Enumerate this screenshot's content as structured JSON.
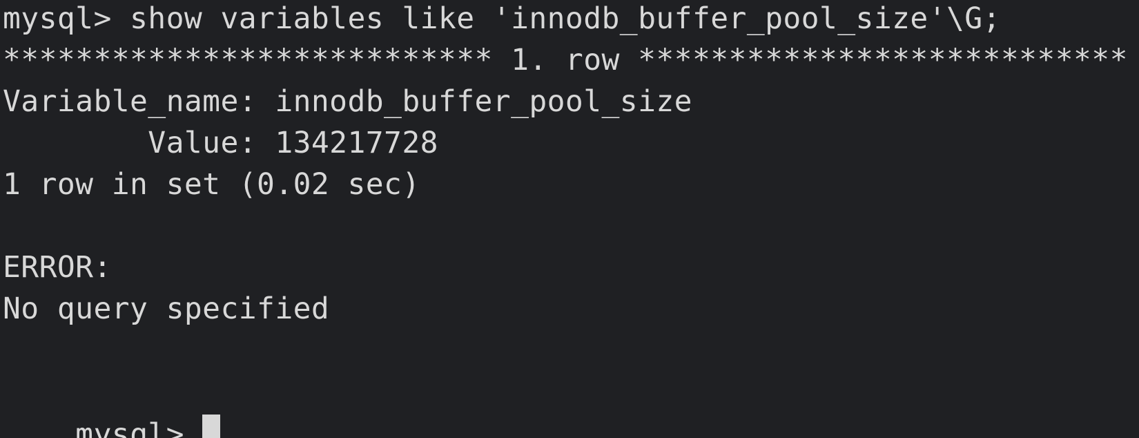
{
  "terminal": {
    "command_line": "mysql> show variables like 'innodb_buffer_pool_size'\\G;",
    "row_separator": "*************************** 1. row ***************************",
    "variable_name_line": "Variable_name: innodb_buffer_pool_size",
    "value_line": "        Value: 134217728",
    "result_summary": "1 row in set (0.02 sec)",
    "error_label": "ERROR:",
    "error_message": "No query specified",
    "prompt": "mysql> "
  },
  "colors": {
    "background": "#1f2023",
    "text": "#d8d8d8"
  }
}
